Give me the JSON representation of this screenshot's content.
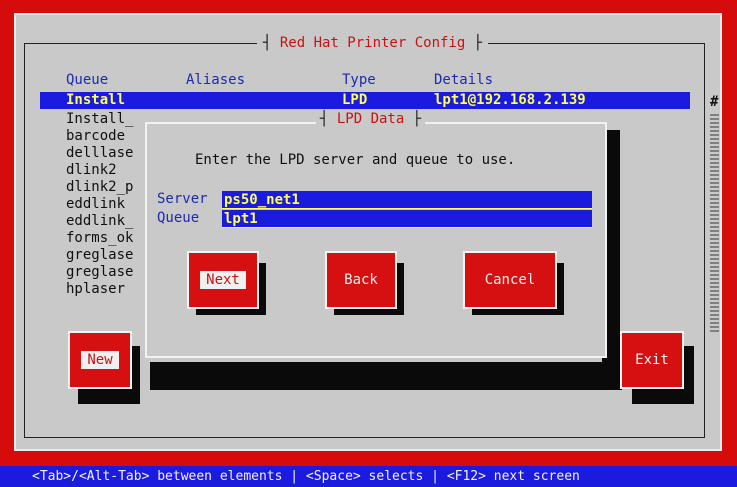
{
  "window": {
    "title": "Red Hat Printer Config"
  },
  "table": {
    "headers": {
      "queue": "Queue",
      "aliases": "Aliases",
      "type": "Type",
      "details": "Details"
    },
    "selected_row": {
      "queue": "Install",
      "type": "LPD",
      "details": "lpt1@192.168.2.139"
    },
    "queues": [
      "Install_",
      "barcode",
      "delllase",
      "dlink2",
      "dlink2_p",
      "eddlink",
      "eddlink_",
      "forms_ok",
      "greglase",
      "greglase",
      "hplaser"
    ],
    "scrollbar_glyph": "#"
  },
  "buttons": {
    "new": "New",
    "exit": "Exit"
  },
  "dialog": {
    "title": "LPD Data",
    "prompt": "Enter the LPD server and queue to use.",
    "server_label": "Server",
    "server_value": "ps50_net1",
    "queue_label": "Queue",
    "queue_value": "lpt1",
    "buttons": {
      "next": "Next",
      "back": "Back",
      "cancel": "Cancel"
    }
  },
  "status_bar": {
    "text": "<Tab>/<Alt-Tab> between elements   |  <Space> selects   |  <F12> next screen"
  },
  "colors": {
    "background": "#d60c0c",
    "window": "#c9c9c9",
    "selection": "#1b1be0",
    "selection_text": "#ffff55",
    "label_blue": "#1b2bb0"
  }
}
